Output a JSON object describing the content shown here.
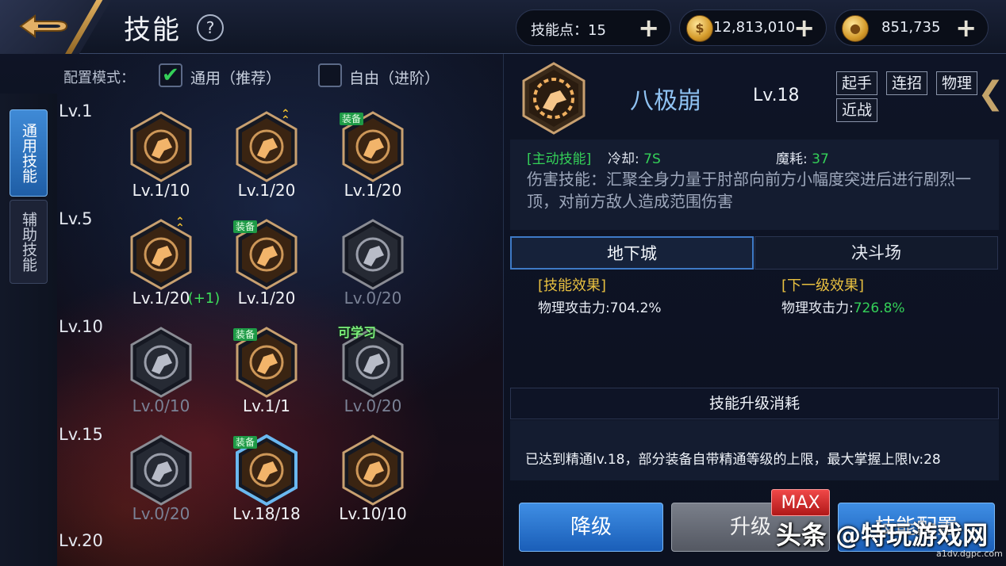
{
  "header": {
    "title": "技能",
    "help": "?",
    "skill_points_label": "技能点：15",
    "gold": "12,813,010",
    "coupons": "851,735",
    "plus": "+"
  },
  "side_tabs": [
    "通用技能",
    "辅助技能"
  ],
  "config_mode": {
    "label": "配置模式：",
    "option_general": "通用（推荐）",
    "option_free": "自由（进阶）"
  },
  "level_rows": [
    "Lv.1",
    "Lv.5",
    "Lv.10",
    "Lv.15",
    "Lv.20"
  ],
  "skills": [
    {
      "level": "Lv.1/10",
      "learned": true,
      "icon": "palm-swirl-icon"
    },
    {
      "level": "Lv.1/20",
      "learned": true,
      "icon": "kick-icon",
      "rank_up": true
    },
    {
      "level": "Lv.1/20",
      "learned": true,
      "icon": "explosion-icon",
      "equip": "装备"
    },
    {
      "level": "Lv.1/20",
      "learned": true,
      "icon": "dash-wave-icon",
      "rank_up": true,
      "bonus": "(+1)"
    },
    {
      "level": "Lv.1/20",
      "learned": true,
      "icon": "flip-icon",
      "equip": "装备"
    },
    {
      "level": "Lv.0/20",
      "learned": false,
      "icon": "grapple-icon"
    },
    {
      "level": "Lv.0/10",
      "learned": false,
      "icon": "crowd-icon"
    },
    {
      "level": "Lv.1/1",
      "learned": true,
      "icon": "brace-icon",
      "equip": "装备"
    },
    {
      "level": "Lv.0/20",
      "learned": false,
      "icon": "flying-kick-icon",
      "learnable": "可学习"
    },
    {
      "level": "Lv.0/20",
      "learned": false,
      "icon": "stomp-icon"
    },
    {
      "level": "Lv.18/18",
      "learned": true,
      "icon": "elbow-strike-icon",
      "equip": "装备",
      "selected": true
    },
    {
      "level": "Lv.10/10",
      "learned": true,
      "icon": "body-aura-icon"
    }
  ],
  "detail": {
    "name": "八极崩",
    "level": "Lv.18",
    "tags": [
      "起手",
      "连招",
      "物理",
      "近战"
    ],
    "active_tag": "[主动技能]",
    "cooldown_label": "冷却:",
    "cooldown_value": "7S",
    "mana_label": "魔耗:",
    "mana_value": "37",
    "description": "伤害技能：汇聚全身力量于肘部向前方小幅度突进后进行剧烈一顶，对前方敌人造成范围伤害",
    "mode_tabs": [
      "地下城",
      "决斗场"
    ],
    "effect_title": "[技能效果]",
    "effect_label": "物理攻击力:",
    "effect_value": "704.2%",
    "next_title": "[下一级效果]",
    "next_label": "物理攻击力:",
    "next_value": "726.8%",
    "cost_title": "技能升级消耗",
    "cost_note": "已达到精通lv.18，部分装备自带精通等级的上限，最大掌握上限lv:28"
  },
  "buttons": {
    "downgrade": "降级",
    "upgrade": "升级",
    "max": "MAX",
    "config": "技能配置"
  },
  "watermark": {
    "main": "头条 @特玩游戏网",
    "small": "a1dv.dgpc.com"
  },
  "colors": {
    "accent_blue": "#1f5ea6",
    "green": "#34d058",
    "gold": "#e8c040",
    "name_blue": "#8fc2f2"
  }
}
